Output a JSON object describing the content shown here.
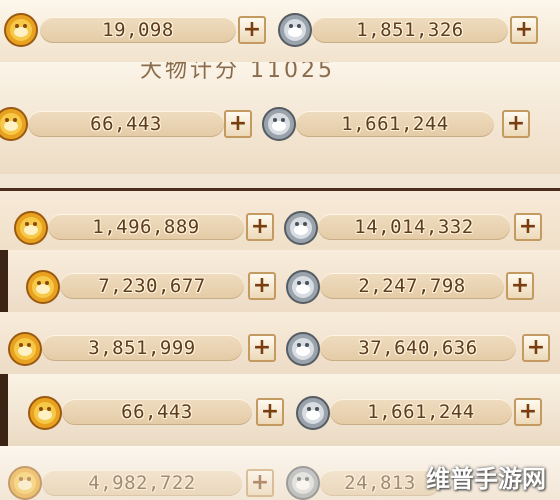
{
  "rows": [
    {
      "gold": "19,098",
      "silver": "1,851,326"
    },
    {
      "gold": "66,443",
      "silver": "1,661,244"
    },
    {
      "gold": "1,496,889",
      "silver": "14,014,332"
    },
    {
      "gold": "7,230,677",
      "silver": "2,247,798"
    },
    {
      "gold": "3,851,999",
      "silver": "37,640,636"
    },
    {
      "gold": "66,443",
      "silver": "1,661,244"
    },
    {
      "gold": "4,982,722",
      "silver": "24,813"
    }
  ],
  "plus_label": "+",
  "partial_text": "大物计分 11025",
  "watermark": "维普手游网",
  "icons": {
    "gold": "gold-coin-icon",
    "silver": "silver-coin-icon"
  },
  "colors": {
    "value_text": "#5e3c1f",
    "plus_text": "#7a3d10",
    "gold_coin": "#e9a21f",
    "silver_coin": "#9aa3ab"
  }
}
